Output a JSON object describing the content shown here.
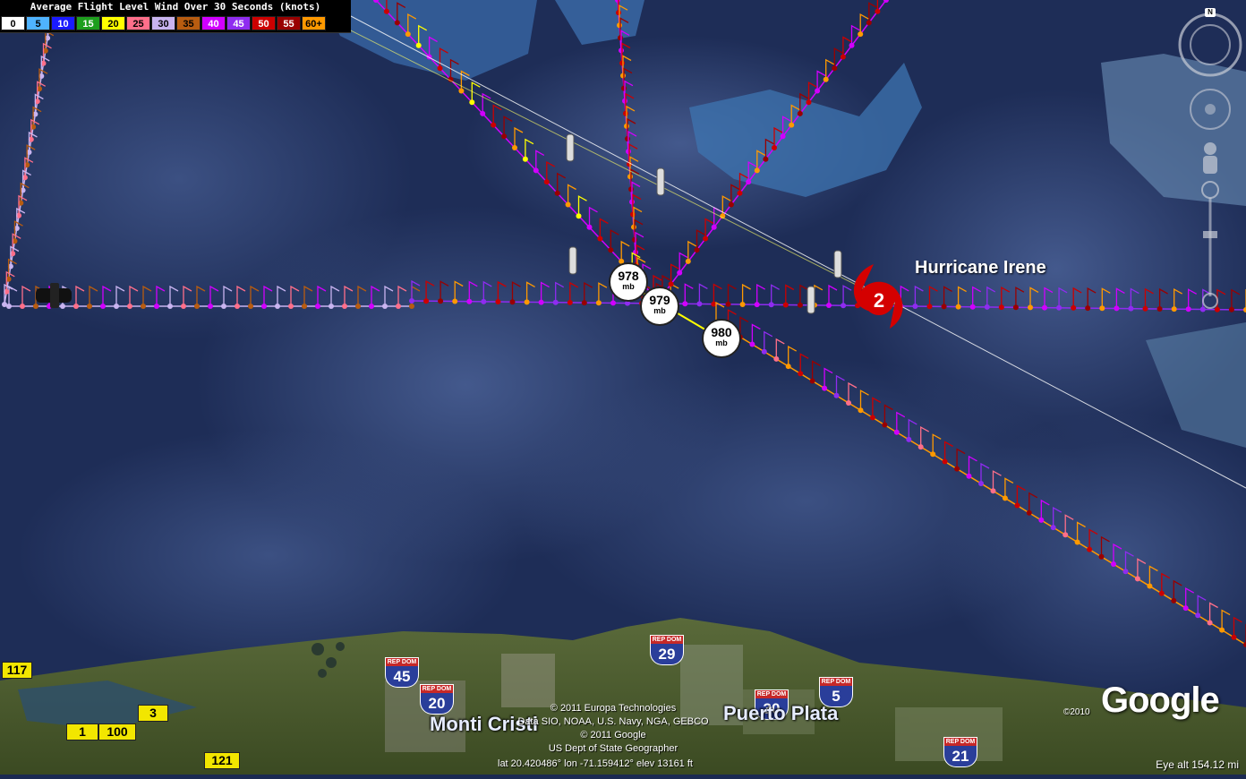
{
  "legend": {
    "title": "Average Flight Level Wind Over 30 Seconds (knots)",
    "bins": [
      {
        "label": "0",
        "color": "#ffffff"
      },
      {
        "label": "5",
        "color": "#4fb3ff"
      },
      {
        "label": "10",
        "color": "#1a1aff"
      },
      {
        "label": "15",
        "color": "#1e9e1e"
      },
      {
        "label": "20",
        "color": "#ffff00"
      },
      {
        "label": "25",
        "color": "#ff6f8a"
      },
      {
        "label": "30",
        "color": "#c9b4f0"
      },
      {
        "label": "35",
        "color": "#b85c10"
      },
      {
        "label": "40",
        "color": "#d100ff"
      },
      {
        "label": "45",
        "color": "#8f2cf0"
      },
      {
        "label": "50",
        "color": "#cc0000"
      },
      {
        "label": "55",
        "color": "#990000"
      },
      {
        "label": "60+",
        "color": "#ff9900"
      }
    ]
  },
  "storm": {
    "name": "Hurricane Irene",
    "category": "2",
    "color": "#d40000"
  },
  "pressure_readings": [
    {
      "value": "978",
      "unit": "mb"
    },
    {
      "value": "979",
      "unit": "mb"
    },
    {
      "value": "980",
      "unit": "mb"
    }
  ],
  "places": {
    "monti_cristi": "Monti Cristi",
    "puerto_plata": "Puerto Plata"
  },
  "route_shields": [
    {
      "top": "REP DOM",
      "number": "45"
    },
    {
      "top": "REP DOM",
      "number": "20"
    },
    {
      "top": "REP DOM",
      "number": "29"
    },
    {
      "top": "REP DOM",
      "number": "30"
    },
    {
      "top": "REP DOM",
      "number": "5"
    },
    {
      "top": "REP DOM",
      "number": "21"
    }
  ],
  "yellow_roads": [
    "117",
    "3",
    "1",
    "100",
    "121"
  ],
  "credits": [
    "© 2011 Europa Technologies",
    "Data SIO, NOAA, U.S. Navy, NGA, GEBCO",
    "© 2011 Google",
    "US Dept of State Geographer"
  ],
  "status": {
    "coords": "lat  20.420486°  lon  -71.159412°  elev  13161 ft",
    "eye_alt": "Eye alt   154.12 mi"
  },
  "branding": {
    "year": "©2010",
    "logo": "Google"
  },
  "nav_controls": {
    "north": "N",
    "icons": [
      "compass-ring-icon",
      "look-joystick-icon",
      "pegman-icon",
      "zoom-slider-icon"
    ]
  }
}
